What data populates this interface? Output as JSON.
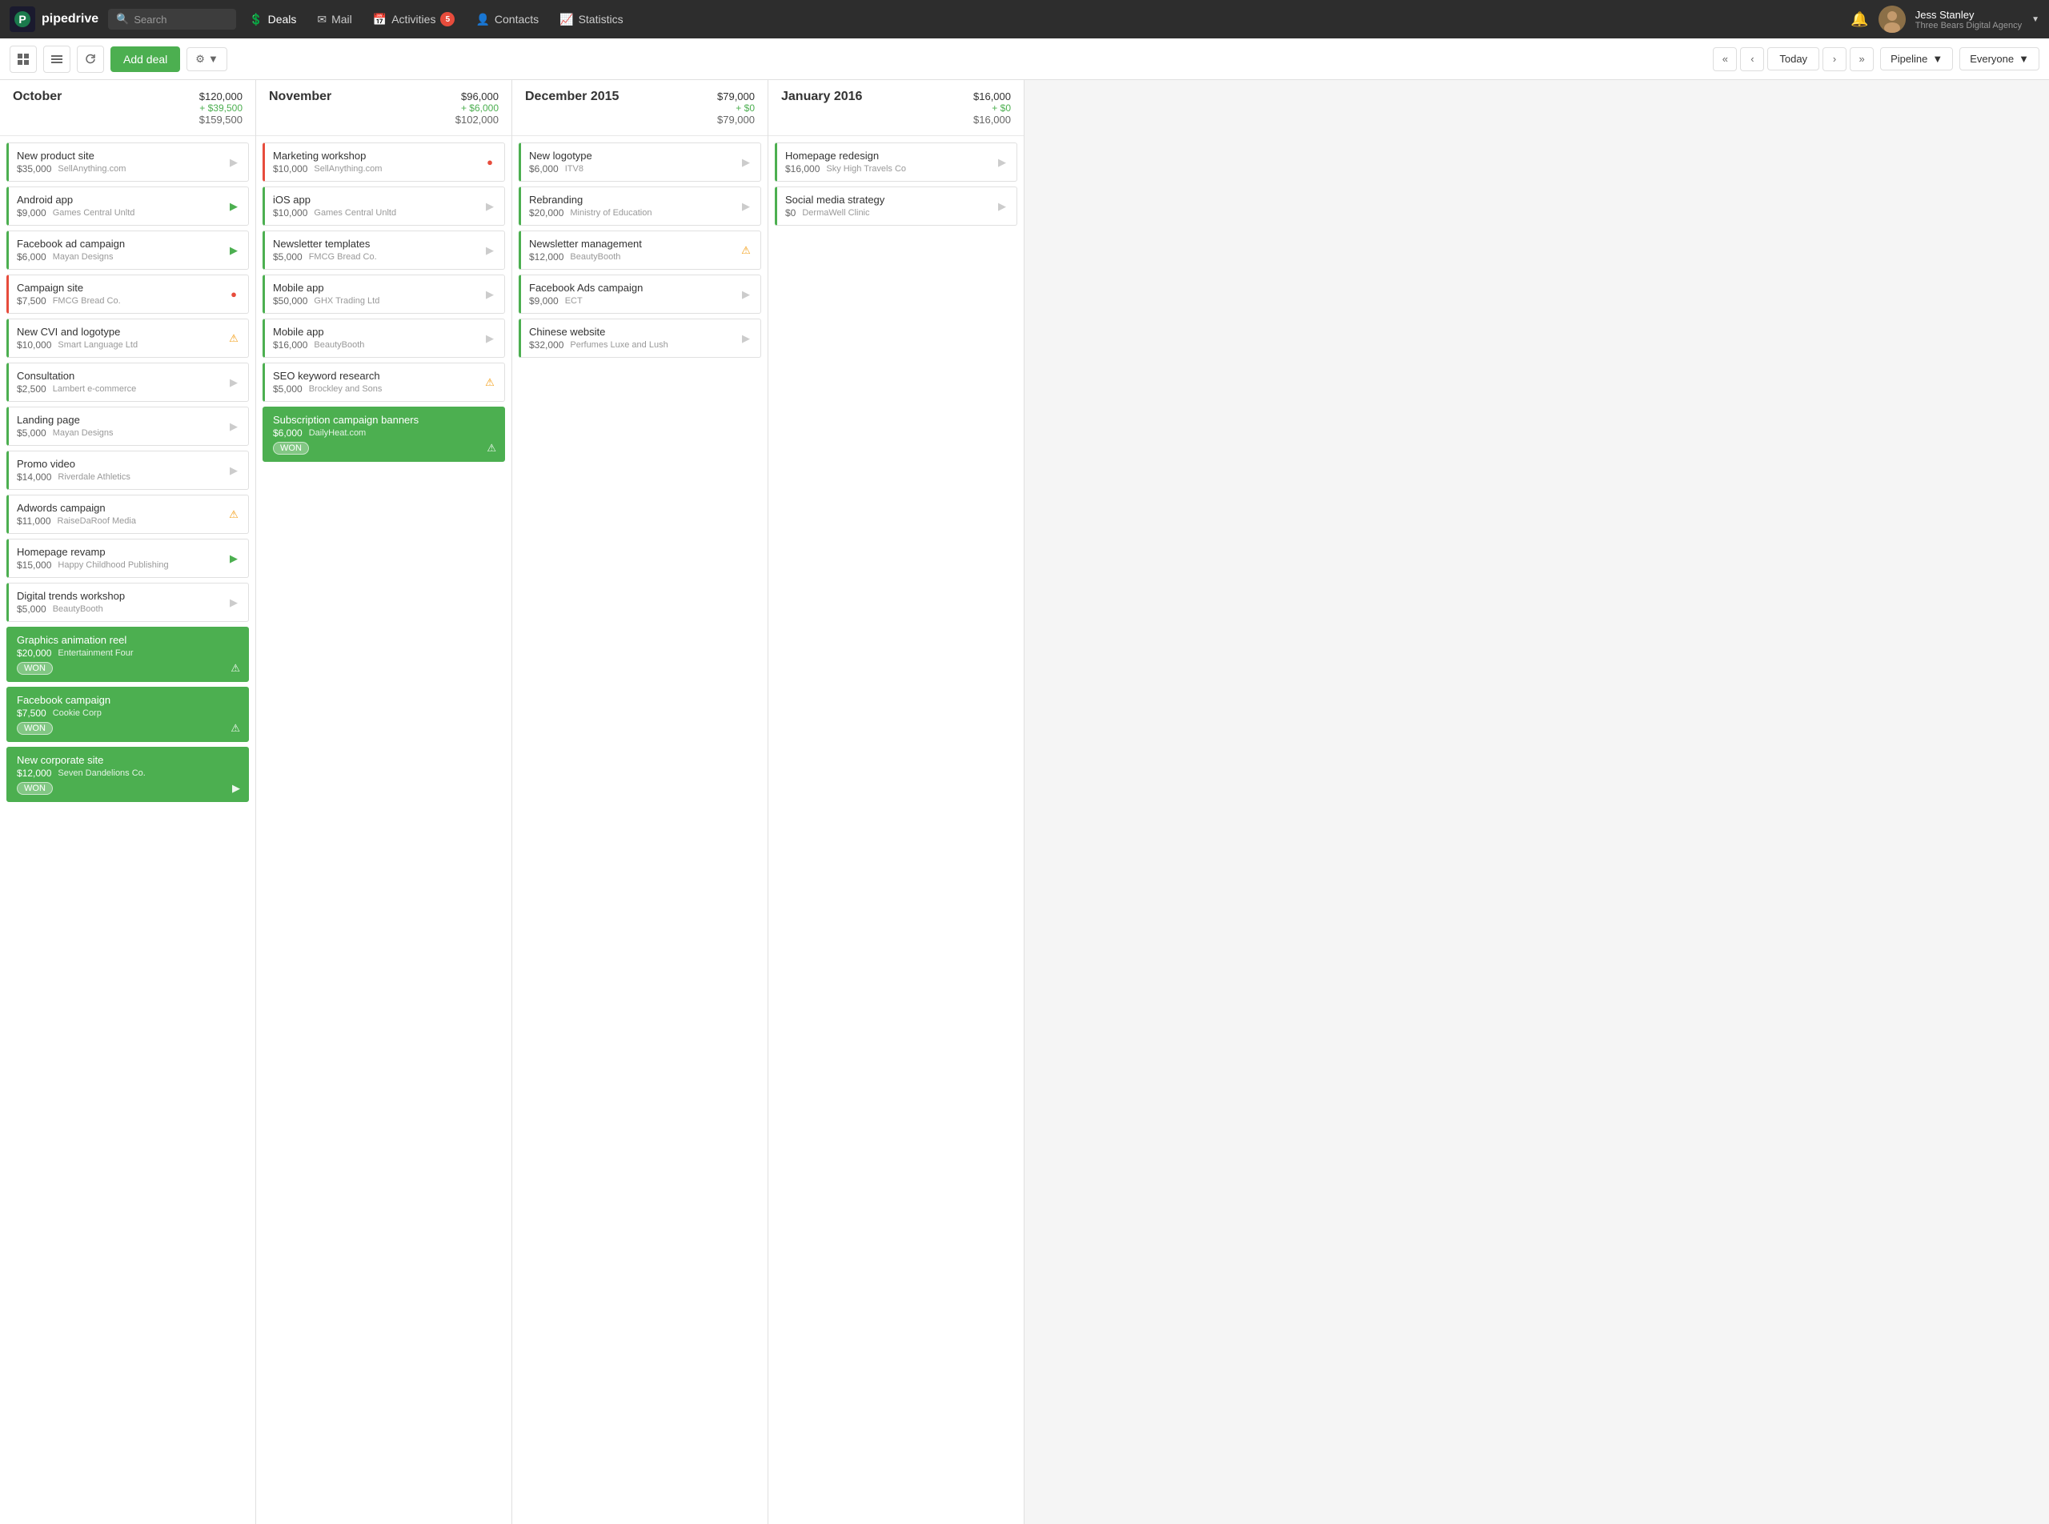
{
  "nav": {
    "logo": "pipedrive",
    "search_placeholder": "Search",
    "items": [
      {
        "label": "Deals",
        "icon": "dollar-circle",
        "active": true,
        "badge": null
      },
      {
        "label": "Mail",
        "icon": "mail",
        "active": false,
        "badge": null
      },
      {
        "label": "Activities",
        "icon": "activity",
        "active": false,
        "badge": "5"
      },
      {
        "label": "Contacts",
        "icon": "person",
        "active": false,
        "badge": null
      },
      {
        "label": "Statistics",
        "icon": "chart",
        "active": false,
        "badge": null
      }
    ],
    "user": {
      "name": "Jess Stanley",
      "company": "Three Bears Digital Agency"
    }
  },
  "toolbar": {
    "add_deal": "Add deal",
    "today": "Today",
    "pipeline": "Pipeline",
    "everyone": "Everyone"
  },
  "columns": [
    {
      "id": "october",
      "title": "October",
      "amount_main": "$120,000",
      "amount_change": "+ $39,500",
      "amount_total": "$159,500",
      "cards": [
        {
          "title": "New product site",
          "value": "$35,000",
          "company": "SellAnything.com",
          "status": "normal",
          "action": "circle-arrow",
          "won": false,
          "warning": false
        },
        {
          "title": "Android app",
          "value": "$9,000",
          "company": "Games Central Unltd",
          "status": "green-arrow",
          "action": "green-arrow",
          "won": false,
          "warning": false
        },
        {
          "title": "Facebook ad campaign",
          "value": "$6,000",
          "company": "Mayan Designs",
          "status": "green-arrow",
          "action": "green-arrow",
          "won": false,
          "warning": false
        },
        {
          "title": "Campaign site",
          "value": "$7,500",
          "company": "FMCG Bread Co.",
          "status": "red-arrow",
          "action": "red-arrow",
          "won": false,
          "warning": false
        },
        {
          "title": "New CVI and logotype",
          "value": "$10,000",
          "company": "Smart Language Ltd",
          "status": "warning",
          "action": "warning",
          "won": false,
          "warning": true
        },
        {
          "title": "Consultation",
          "value": "$2,500",
          "company": "Lambert e-commerce",
          "status": "normal",
          "action": "circle-arrow",
          "won": false,
          "warning": false
        },
        {
          "title": "Landing page",
          "value": "$5,000",
          "company": "Mayan Designs",
          "status": "normal",
          "action": "circle-arrow",
          "won": false,
          "warning": false
        },
        {
          "title": "Promo video",
          "value": "$14,000",
          "company": "Riverdale Athletics",
          "status": "normal",
          "action": "circle-arrow",
          "won": false,
          "warning": false
        },
        {
          "title": "Adwords campaign",
          "value": "$11,000",
          "company": "RaiseDaRoof Media",
          "status": "warning",
          "action": "warning",
          "won": false,
          "warning": true
        },
        {
          "title": "Homepage revamp",
          "value": "$15,000",
          "company": "Happy Childhood Publishing",
          "status": "green-arrow",
          "action": "green-arrow",
          "won": false,
          "warning": false
        },
        {
          "title": "Digital trends workshop",
          "value": "$5,000",
          "company": "BeautyBooth",
          "status": "normal",
          "action": "circle-arrow",
          "won": false,
          "warning": false
        },
        {
          "title": "Graphics animation reel",
          "value": "$20,000",
          "company": "Entertainment Four",
          "status": "won-warning",
          "action": "warning",
          "won": true,
          "warning": true
        },
        {
          "title": "Facebook campaign",
          "value": "$7,500",
          "company": "Cookie Corp",
          "status": "won-warning",
          "action": "warning",
          "won": true,
          "warning": true
        },
        {
          "title": "New corporate site",
          "value": "$12,000",
          "company": "Seven Dandelions Co.",
          "status": "won-arrow",
          "action": "green-arrow",
          "won": true,
          "warning": false
        }
      ]
    },
    {
      "id": "november",
      "title": "November",
      "amount_main": "$96,000",
      "amount_change": "+ $6,000",
      "amount_total": "$102,000",
      "cards": [
        {
          "title": "Marketing workshop",
          "value": "$10,000",
          "company": "SellAnything.com",
          "status": "red-circle",
          "action": "red-circle",
          "won": false,
          "warning": false
        },
        {
          "title": "iOS app",
          "value": "$10,000",
          "company": "Games Central Unltd",
          "status": "normal",
          "action": "circle-arrow",
          "won": false,
          "warning": false
        },
        {
          "title": "Newsletter templates",
          "value": "$5,000",
          "company": "FMCG Bread Co.",
          "status": "normal",
          "action": "circle-arrow",
          "won": false,
          "warning": false
        },
        {
          "title": "Mobile app",
          "value": "$50,000",
          "company": "GHX Trading Ltd",
          "status": "normal",
          "action": "circle-arrow",
          "won": false,
          "warning": false
        },
        {
          "title": "Mobile app",
          "value": "$16,000",
          "company": "BeautyBooth",
          "status": "normal",
          "action": "circle-arrow",
          "won": false,
          "warning": false
        },
        {
          "title": "SEO keyword research",
          "value": "$5,000",
          "company": "Brockley and Sons",
          "status": "warning",
          "action": "warning",
          "won": false,
          "warning": true
        },
        {
          "title": "Subscription campaign banners",
          "value": "$6,000",
          "company": "DailyHeat.com",
          "status": "won-warning",
          "action": "warning",
          "won": true,
          "warning": true
        }
      ]
    },
    {
      "id": "december",
      "title": "December 2015",
      "amount_main": "$79,000",
      "amount_change": "+ $0",
      "amount_total": "$79,000",
      "cards": [
        {
          "title": "New logotype",
          "value": "$6,000",
          "company": "ITV8",
          "status": "normal",
          "action": "circle-arrow",
          "won": false,
          "warning": false
        },
        {
          "title": "Rebranding",
          "value": "$20,000",
          "company": "Ministry of Education",
          "status": "normal",
          "action": "circle-arrow",
          "won": false,
          "warning": false
        },
        {
          "title": "Newsletter management",
          "value": "$12,000",
          "company": "BeautyBooth",
          "status": "warning",
          "action": "warning",
          "won": false,
          "warning": true
        },
        {
          "title": "Facebook Ads campaign",
          "value": "$9,000",
          "company": "ECT",
          "status": "normal",
          "action": "circle-arrow",
          "won": false,
          "warning": false
        },
        {
          "title": "Chinese website",
          "value": "$32,000",
          "company": "Perfumes Luxe and Lush",
          "status": "normal",
          "action": "circle-arrow",
          "won": false,
          "warning": false
        }
      ]
    },
    {
      "id": "january",
      "title": "January 2016",
      "amount_main": "$16,000",
      "amount_change": "+ $0",
      "amount_total": "$16,000",
      "cards": [
        {
          "title": "Homepage redesign",
          "value": "$16,000",
          "company": "Sky High Travels Co",
          "status": "normal",
          "action": "circle-arrow",
          "won": false,
          "warning": false
        },
        {
          "title": "Social media strategy",
          "value": "$0",
          "company": "DermaWell Clinic",
          "status": "normal",
          "action": "circle-arrow",
          "won": false,
          "warning": false
        }
      ]
    }
  ]
}
